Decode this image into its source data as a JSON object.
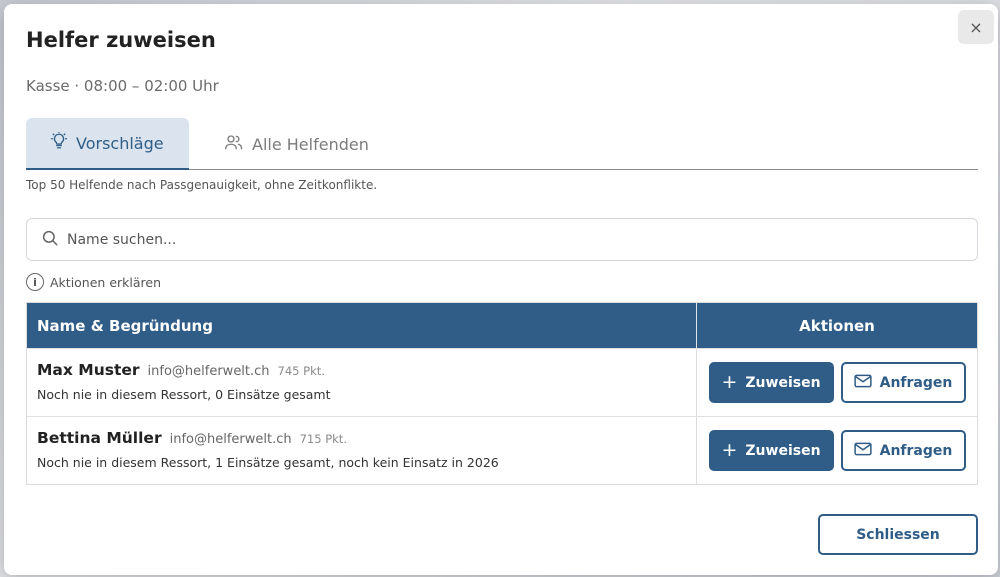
{
  "dialog": {
    "title": "Helfer zuweisen",
    "subtitle": "Kasse · 08:00 – 02:00 Uhr",
    "close_icon": "×"
  },
  "tabs": [
    {
      "label": "Vorschläge",
      "icon": "lightbulb-icon",
      "active": true
    },
    {
      "label": "Alle Helfenden",
      "icon": "users-icon",
      "active": false
    }
  ],
  "hint": "Top 50 Helfende nach Passgenauigkeit, ohne Zeitkonflikte.",
  "search": {
    "placeholder": "Name suchen..."
  },
  "explain_actions": "Aktionen erklären",
  "table": {
    "headers": {
      "name": "Name & Begründung",
      "actions": "Aktionen"
    },
    "rows": [
      {
        "name": "Max Muster",
        "email": "info@helferwelt.ch",
        "points": "745 Pkt.",
        "reason": "Noch nie in diesem Ressort, 0 Einsätze gesamt",
        "assign_label": "Zuweisen",
        "request_label": "Anfragen"
      },
      {
        "name": "Bettina Müller",
        "email": "info@helferwelt.ch",
        "points": "715 Pkt.",
        "reason": "Noch nie in diesem Ressort, 1 Einsätze gesamt, noch kein Einsatz in 2026",
        "assign_label": "Zuweisen",
        "request_label": "Anfragen"
      }
    ]
  },
  "footer": {
    "close_label": "Schliessen"
  },
  "colors": {
    "primary": "#2f5d88",
    "tab_active_bg": "#dbe4ee"
  }
}
